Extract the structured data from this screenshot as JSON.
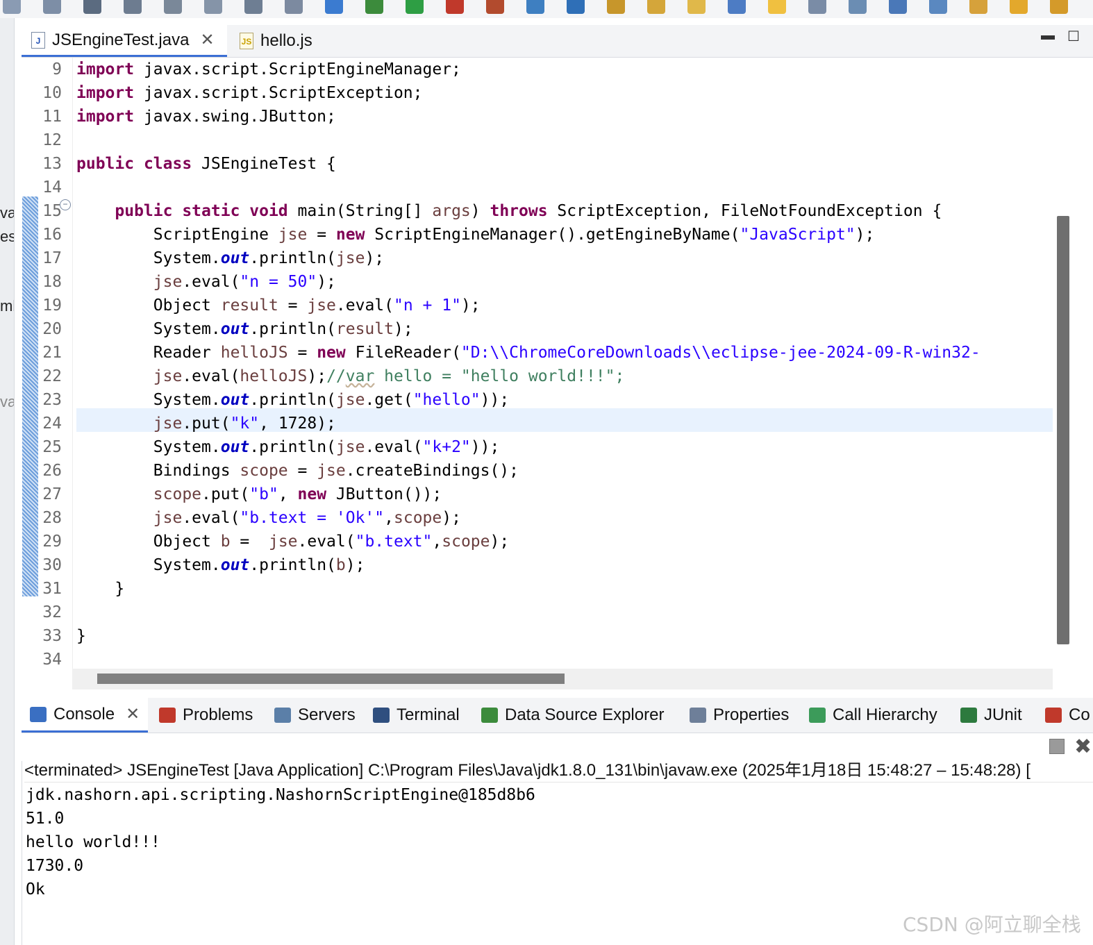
{
  "toolbar": {
    "icons": [
      "run-last-icon",
      "pause-icon",
      "stop-icon",
      "disconnect-icon",
      "step-into-icon",
      "step-over-icon",
      "step-return-icon",
      "drop-to-frame-icon",
      "use-step-filters-icon",
      "debug-icon",
      "run-icon",
      "coverage-icon",
      "external-tools-icon",
      "new-server-icon",
      "web-browser-icon",
      "open-type-icon",
      "open-task-icon",
      "search-icon",
      "toggle-mark-occurrences-icon",
      "edit-icon",
      "toggle-block-selection-icon",
      "show-whitespace-icon",
      "globe-icon",
      "next-annotation-icon",
      "previous-annotation-icon",
      "back-icon",
      "forward-icon"
    ]
  },
  "left_strip": {
    "fragments": [
      "va",
      "es",
      "ml",
      "va"
    ]
  },
  "editor_tabs": [
    {
      "label": "JSEngineTest.java",
      "icon": "java-file-icon",
      "active": true
    },
    {
      "label": "hello.js",
      "icon": "js-file-icon",
      "active": false
    }
  ],
  "editor": {
    "highlighted_line": 24,
    "lines": [
      {
        "num": "9",
        "tokens": [
          [
            "kw",
            "import"
          ],
          [
            "",
            "javax.script.ScriptEngineManager;"
          ]
        ]
      },
      {
        "num": "10",
        "tokens": [
          [
            "kw",
            "import"
          ],
          [
            "",
            "javax.script.ScriptException;"
          ]
        ]
      },
      {
        "num": "11",
        "tokens": [
          [
            "kw",
            "import"
          ],
          [
            "",
            "javax.swing.JButton;"
          ]
        ]
      },
      {
        "num": "12",
        "tokens": []
      },
      {
        "num": "13",
        "tokens": [
          [
            "kw",
            "public"
          ],
          [
            "kw",
            "class"
          ],
          [
            "",
            "JSEngineTest {"
          ]
        ]
      },
      {
        "num": "14",
        "tokens": []
      },
      {
        "num": "15",
        "tokens": [
          [
            "",
            "    "
          ],
          [
            "kw",
            "public"
          ],
          [
            "kw",
            "static"
          ],
          [
            "kw",
            "void"
          ],
          [
            "",
            "main(String[] "
          ],
          [
            "vr",
            "args"
          ],
          [
            "",
            ") "
          ],
          [
            "kw",
            "throws"
          ],
          [
            "",
            " ScriptException, FileNotFoundException {"
          ]
        ]
      },
      {
        "num": "16",
        "tokens": [
          [
            "",
            "        ScriptEngine "
          ],
          [
            "vr",
            "jse"
          ],
          [
            "",
            " = "
          ],
          [
            "kw",
            "new"
          ],
          [
            "",
            " ScriptEngineManager().getEngineByName("
          ],
          [
            "str",
            "\"JavaScript\""
          ],
          [
            "",
            ");"
          ]
        ]
      },
      {
        "num": "17",
        "tokens": [
          [
            "",
            "        System."
          ],
          [
            "fld",
            "out"
          ],
          [
            "",
            ".println("
          ],
          [
            "vr",
            "jse"
          ],
          [
            "",
            ");"
          ]
        ]
      },
      {
        "num": "18",
        "tokens": [
          [
            "",
            "        "
          ],
          [
            "vr",
            "jse"
          ],
          [
            "",
            ".eval("
          ],
          [
            "str",
            "\"n = 50\""
          ],
          [
            "",
            ");"
          ]
        ]
      },
      {
        "num": "19",
        "tokens": [
          [
            "",
            "        Object "
          ],
          [
            "vr",
            "result"
          ],
          [
            "",
            " = "
          ],
          [
            "vr",
            "jse"
          ],
          [
            "",
            ".eval("
          ],
          [
            "str",
            "\"n + 1\""
          ],
          [
            "",
            ");"
          ]
        ]
      },
      {
        "num": "20",
        "tokens": [
          [
            "",
            "        System."
          ],
          [
            "fld",
            "out"
          ],
          [
            "",
            ".println("
          ],
          [
            "vr",
            "result"
          ],
          [
            "",
            ");"
          ]
        ]
      },
      {
        "num": "21",
        "tokens": [
          [
            "",
            "        Reader "
          ],
          [
            "vr",
            "helloJS"
          ],
          [
            "",
            " = "
          ],
          [
            "kw",
            "new"
          ],
          [
            "",
            " FileReader("
          ],
          [
            "str",
            "\"D:\\\\ChromeCoreDownloads\\\\eclipse-jee-2024-09-R-win32-"
          ]
        ]
      },
      {
        "num": "22",
        "tokens": [
          [
            "",
            "        "
          ],
          [
            "vr",
            "jse"
          ],
          [
            "",
            ".eval("
          ],
          [
            "vr",
            "helloJS"
          ],
          [
            "",
            ");"
          ],
          [
            "cm",
            "//"
          ],
          [
            "cmu",
            "var"
          ],
          [
            "cm",
            " hello = \"hello world!!!\";"
          ]
        ]
      },
      {
        "num": "23",
        "tokens": [
          [
            "",
            "        System."
          ],
          [
            "fld",
            "out"
          ],
          [
            "",
            ".println("
          ],
          [
            "vr",
            "jse"
          ],
          [
            "",
            ".get("
          ],
          [
            "str",
            "\"hello\""
          ],
          [
            "",
            "));"
          ]
        ]
      },
      {
        "num": "24",
        "tokens": [
          [
            "",
            "        "
          ],
          [
            "vr",
            "jse"
          ],
          [
            "",
            ".put("
          ],
          [
            "str",
            "\"k\""
          ],
          [
            "",
            ", 1728);"
          ]
        ]
      },
      {
        "num": "25",
        "tokens": [
          [
            "",
            "        System."
          ],
          [
            "fld",
            "out"
          ],
          [
            "",
            ".println("
          ],
          [
            "vr",
            "jse"
          ],
          [
            "",
            ".eval("
          ],
          [
            "str",
            "\"k+2\""
          ],
          [
            "",
            "));"
          ]
        ]
      },
      {
        "num": "26",
        "tokens": [
          [
            "",
            "        Bindings "
          ],
          [
            "vr",
            "scope"
          ],
          [
            "",
            " = "
          ],
          [
            "vr",
            "jse"
          ],
          [
            "",
            ".createBindings();"
          ]
        ]
      },
      {
        "num": "27",
        "tokens": [
          [
            "",
            "        "
          ],
          [
            "vr",
            "scope"
          ],
          [
            "",
            ".put("
          ],
          [
            "str",
            "\"b\""
          ],
          [
            "",
            ", "
          ],
          [
            "kw",
            "new"
          ],
          [
            "",
            " JButton());"
          ]
        ]
      },
      {
        "num": "28",
        "tokens": [
          [
            "",
            "        "
          ],
          [
            "vr",
            "jse"
          ],
          [
            "",
            ".eval("
          ],
          [
            "str",
            "\"b.text = 'Ok'\""
          ],
          [
            "",
            ","
          ],
          [
            "vr",
            "scope"
          ],
          [
            "",
            ");"
          ]
        ]
      },
      {
        "num": "29",
        "tokens": [
          [
            "",
            "        Object "
          ],
          [
            "vr",
            "b"
          ],
          [
            "",
            " =  "
          ],
          [
            "vr",
            "jse"
          ],
          [
            "",
            ".eval("
          ],
          [
            "str",
            "\"b.text\""
          ],
          [
            "",
            ","
          ],
          [
            "vr",
            "scope"
          ],
          [
            "",
            ");"
          ]
        ]
      },
      {
        "num": "30",
        "tokens": [
          [
            "",
            "        System."
          ],
          [
            "fld",
            "out"
          ],
          [
            "",
            ".println("
          ],
          [
            "vr",
            "b"
          ],
          [
            "",
            ");"
          ]
        ]
      },
      {
        "num": "31",
        "tokens": [
          [
            "",
            "    }"
          ]
        ]
      },
      {
        "num": "32",
        "tokens": []
      },
      {
        "num": "33",
        "tokens": [
          [
            "",
            "}"
          ]
        ]
      },
      {
        "num": "34",
        "tokens": []
      }
    ]
  },
  "console_tabs": [
    {
      "label": "Console",
      "icon": "console-icon",
      "active": true,
      "color": "#3a6fc2"
    },
    {
      "label": "Problems",
      "icon": "problems-icon",
      "active": false,
      "color": "#c0392b"
    },
    {
      "label": "Servers",
      "icon": "servers-icon",
      "active": false,
      "color": "#5b7fa8"
    },
    {
      "label": "Terminal",
      "icon": "terminal-icon",
      "active": false,
      "color": "#2f4f7f"
    },
    {
      "label": "Data Source Explorer",
      "icon": "data-source-explorer-icon",
      "active": false,
      "color": "#3c8b3c"
    },
    {
      "label": "Properties",
      "icon": "properties-icon",
      "active": false,
      "color": "#6e7f99"
    },
    {
      "label": "Call Hierarchy",
      "icon": "call-hierarchy-icon",
      "active": false,
      "color": "#3c9b5a"
    },
    {
      "label": "JUnit",
      "icon": "junit-icon",
      "active": false,
      "color": "#2d7a3e"
    },
    {
      "label": "Co",
      "icon": "coverage-view-icon",
      "active": false,
      "color": "#c0392b"
    }
  ],
  "console": {
    "header": "<terminated> JSEngineTest [Java Application] C:\\Program Files\\Java\\jdk1.8.0_131\\bin\\javaw.exe  (2025年1月18日 15:48:27 – 15:48:28) [",
    "output": [
      "jdk.nashorn.api.scripting.NashornScriptEngine@185d8b6",
      "51.0",
      "hello world!!!",
      "1730.0",
      "Ok"
    ]
  },
  "watermark": "CSDN @阿立聊全栈"
}
